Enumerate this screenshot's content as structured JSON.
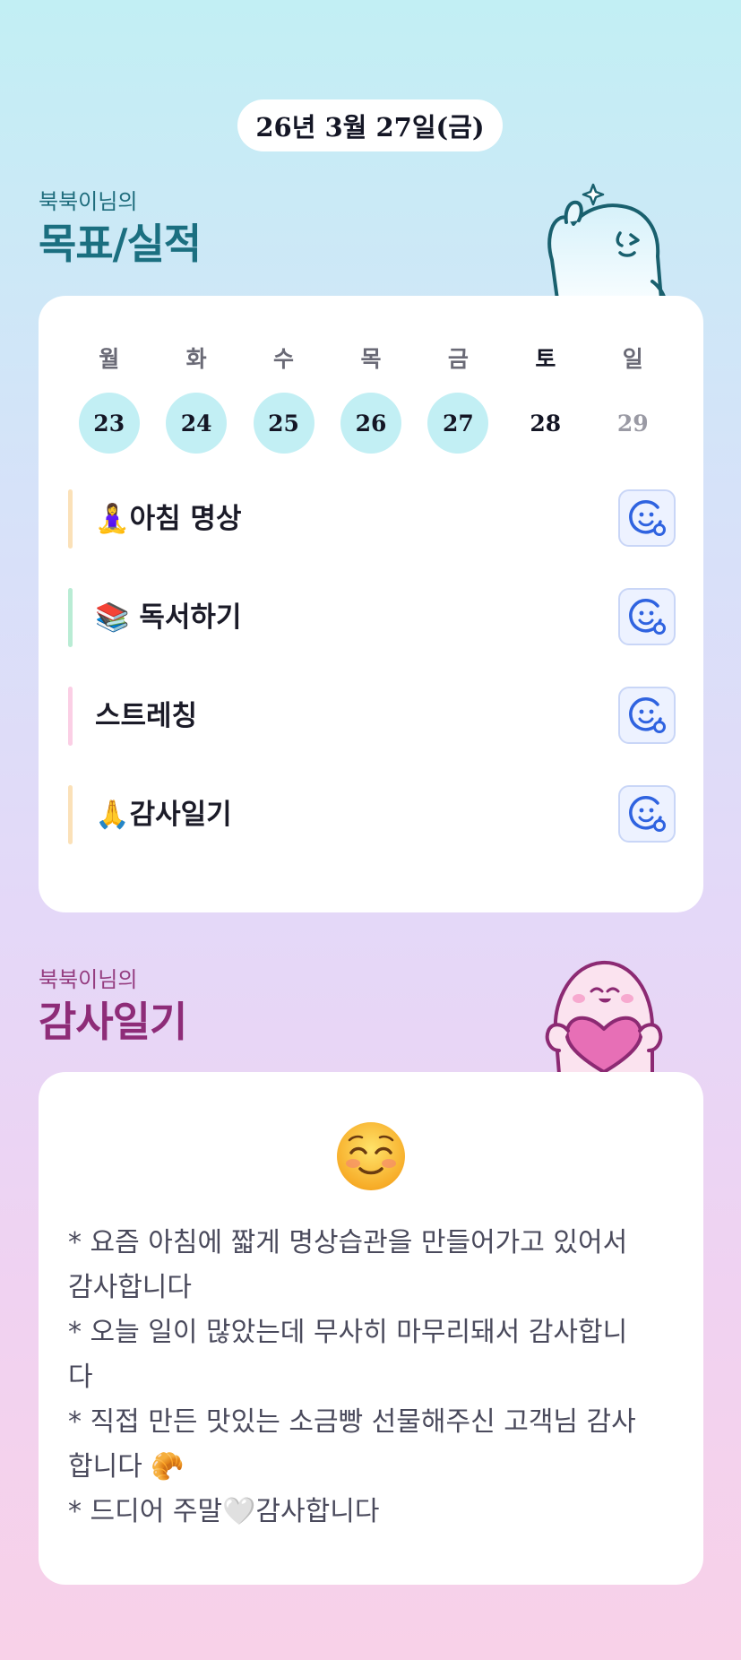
{
  "header": {
    "date": "26년 3월 27일(금)"
  },
  "goals_section": {
    "subtitle": "북북이님의",
    "title": "목표/실적",
    "weekdays": [
      "월",
      "화",
      "수",
      "목",
      "금",
      "토",
      "일"
    ],
    "dates": [
      "23",
      "24",
      "25",
      "26",
      "27",
      "28",
      "29"
    ],
    "completed_days": [
      "23",
      "24",
      "25",
      "26",
      "27"
    ],
    "today": "28",
    "goals": [
      {
        "label": "🧘‍♀️아침 명상",
        "bar_color": "#fbe1b8",
        "status_icon": "smile-face-icon"
      },
      {
        "label": "📚 독서하기",
        "bar_color": "#b9ecd4",
        "status_icon": "smile-face-icon"
      },
      {
        "label": "스트레칭",
        "bar_color": "#fbcfe5",
        "status_icon": "smile-face-icon"
      },
      {
        "label": "🙏감사일기",
        "bar_color": "#fbe1b8",
        "status_icon": "smile-face-icon"
      }
    ],
    "mascot_icon": "waving-ghost-mascot-icon"
  },
  "gratitude_section": {
    "subtitle": "북북이님의",
    "title": "감사일기",
    "mood_icon": "smiling-face-emoji-icon",
    "entries": [
      "* 요즘 아침에 짧게 명상습관을 만들어가고 있어서",
      "감사합니다",
      "* 오늘 일이 많았는데 무사히 마무리돼서 감사합니",
      "다",
      "* 직접 만든 맛있는 소금빵 선물해주신 고객님 감사",
      "합니다 🥐",
      "* 드디어 주말🤍감사합니다"
    ],
    "mascot_icon": "heart-holding-mascot-icon"
  },
  "colors": {
    "accent_teal": "#1b6f80",
    "accent_magenta": "#8e2c78",
    "completed_day_bg": "#c2eff4",
    "check_icon": "#2f63e0"
  }
}
